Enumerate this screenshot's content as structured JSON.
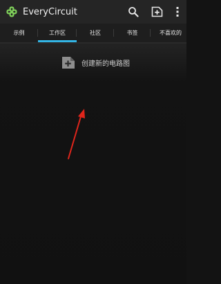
{
  "app": {
    "title": "EveryCircuit"
  },
  "action_bar": {
    "logo_icon": "everycircuit-logo-icon",
    "search_icon": "search-icon",
    "add_icon": "add-circuit-icon",
    "overflow_icon": "overflow-menu-icon"
  },
  "tabs": [
    {
      "label": "示例",
      "active": false
    },
    {
      "label": "工作区",
      "active": true
    },
    {
      "label": "社区",
      "active": false
    },
    {
      "label": "书签",
      "active": false
    },
    {
      "label": "不喜欢的",
      "active": false
    }
  ],
  "main": {
    "new_circuit_label": "创建新的电路图",
    "new_circuit_icon": "add-document-icon"
  },
  "annotation": {
    "arrow_color": "#e0251b"
  },
  "colors": {
    "accent": "#33b5e5",
    "action_bar": "#252525",
    "background": "#131313",
    "logo_green": "#7fd05a"
  }
}
